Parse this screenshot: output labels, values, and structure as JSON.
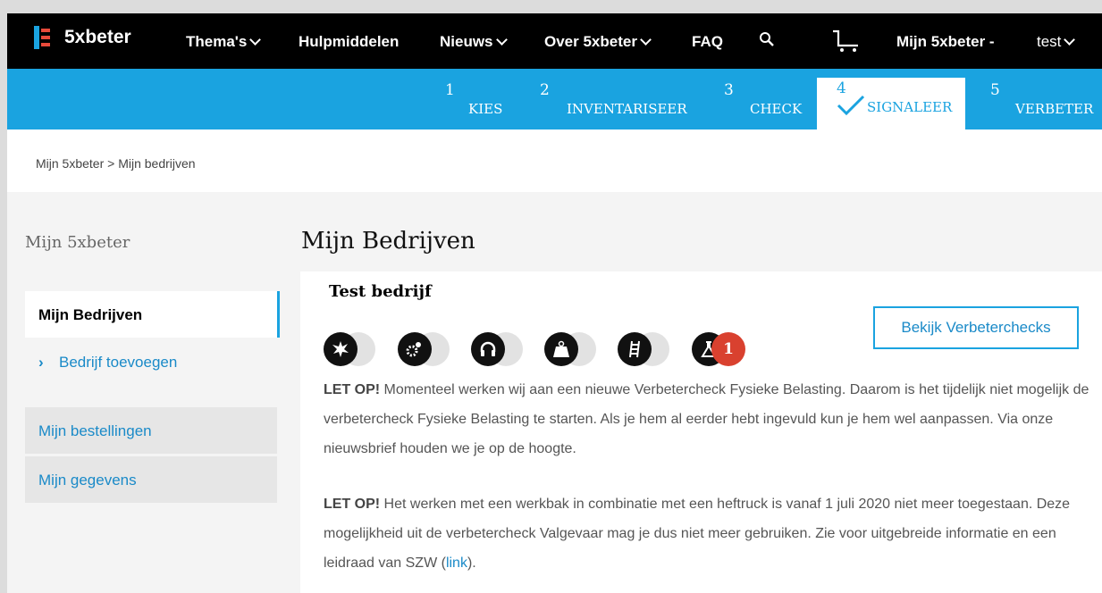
{
  "nav": {
    "brand": "5xbeter",
    "themas": "Thema's",
    "hulpmiddelen": "Hulpmiddelen",
    "nieuws": "Nieuws",
    "over": "Over 5xbeter",
    "faq": "FAQ",
    "mijn": "Mijn 5xbeter -",
    "user": "test"
  },
  "steps": [
    {
      "num": "1",
      "label": "KIES"
    },
    {
      "num": "2",
      "label": "INVENTARISEER"
    },
    {
      "num": "3",
      "label": "CHECK"
    },
    {
      "num": "4",
      "label": "SIGNALEER"
    },
    {
      "num": "5",
      "label": "VERBETER"
    }
  ],
  "breadcrumb": "Mijn 5xbeter > Mijn bedrijven",
  "sidebar": {
    "title": "Mijn 5xbeter",
    "items": [
      "Mijn Bedrijven",
      "Bedrijf toevoegen",
      "Mijn bestellingen",
      "Mijn gegevens"
    ]
  },
  "main": {
    "title": "Mijn Bedrijven",
    "company": "Test bedrijf",
    "button": "Bekijk Verbeterchecks",
    "badge_count": "1",
    "themes": [
      "explosion-icon",
      "machine-icon",
      "headphones-icon",
      "weight-icon",
      "ladder-icon",
      "flask-icon"
    ],
    "notice1_strong": "LET OP!",
    "notice1_text": " Momenteel werken wij aan een nieuwe Verbetercheck Fysieke Belasting. Daarom is het tijdelijk niet mogelijk de verbetercheck Fysieke Belasting te starten. Als je hem al eerder hebt ingevuld kun je hem wel aanpassen. Via onze nieuwsbrief houden we je op de hoogte.",
    "notice2_strong": "LET OP!",
    "notice2_text": " Het werken met een werkbak in combinatie met een heftruck is vanaf 1 juli 2020 niet meer toegestaan. Deze mogelijkheid uit de verbetercheck Valgevaar mag je dus niet meer gebruiken. Zie voor uitgebreide informatie en een leidraad van SZW (",
    "notice2_link": "link",
    "notice2_end": ")."
  },
  "colors": {
    "accent": "#1aa3e0",
    "badge": "#d9412f",
    "nav": "#000000"
  }
}
